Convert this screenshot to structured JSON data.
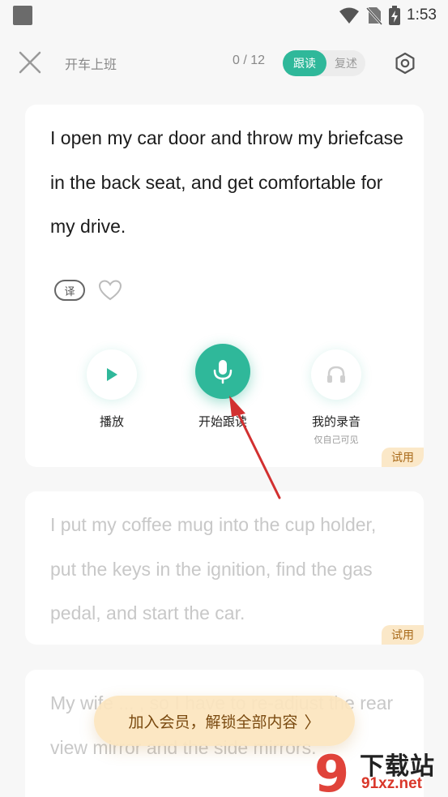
{
  "status_bar": {
    "time": "1:53"
  },
  "header": {
    "title": "开车上班",
    "progress": "0 / 12",
    "mode_active": "跟读",
    "mode_inactive": "复述"
  },
  "cards": [
    {
      "sentence": "I open my car door and throw my briefcase in the back seat, and get comfortable for my drive.",
      "translate_label": "译",
      "badge": "试用"
    },
    {
      "sentence": "I put my coffee mug into the cup holder, put the keys in the ignition, find the gas pedal, and start the car.",
      "badge": "试用"
    },
    {
      "sentence": "My wife ... , so I have to re-adjust the rear view mirror and the side mirrors."
    }
  ],
  "controls": {
    "play_label": "播放",
    "record_label": "开始跟读",
    "mine_label": "我的录音",
    "mine_sub": "仅自己可见"
  },
  "member_button": {
    "label": "加入会员，解锁全部内容",
    "chevron": "〉"
  },
  "watermark": {
    "top": "下载站",
    "bottom": "91xz.net",
    "logo": "9"
  },
  "colors": {
    "accent": "#2fb89a",
    "trial_bg": "#fbe8c8",
    "member_bg": "#fce5be"
  }
}
